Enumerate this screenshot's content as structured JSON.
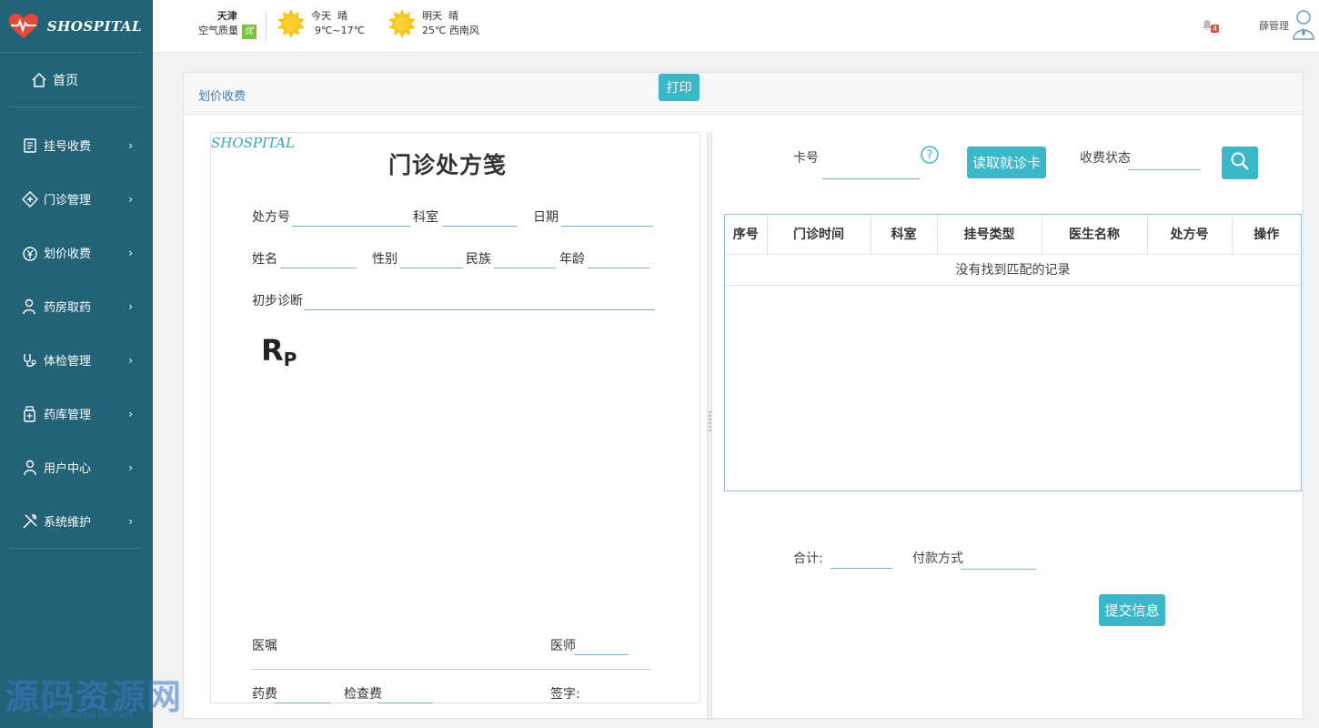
{
  "brand": {
    "name": "SHOSPITAL"
  },
  "sidebar": {
    "home": "首页",
    "items": [
      {
        "label": "挂号收费",
        "icon": "receipt-icon"
      },
      {
        "label": "门诊管理",
        "icon": "clinic-icon"
      },
      {
        "label": "划价收费",
        "icon": "yuan-icon"
      },
      {
        "label": "药房取药",
        "icon": "pharmacy-icon"
      },
      {
        "label": "体检管理",
        "icon": "stethoscope-icon"
      },
      {
        "label": "药库管理",
        "icon": "medicine-bottle-icon"
      },
      {
        "label": "用户中心",
        "icon": "user-icon"
      },
      {
        "label": "系统维护",
        "icon": "tools-icon"
      }
    ]
  },
  "topbar": {
    "city": "天津",
    "air_quality_label": "空气质量",
    "air_quality_value": "优",
    "today": {
      "day": "今天",
      "condition": "晴",
      "temp": "9℃~17℃"
    },
    "tomorrow": {
      "day": "明天",
      "condition": "晴",
      "detail": "25℃ 西南风"
    },
    "notifications": "4",
    "user": "薛管理"
  },
  "panel": {
    "title": "划价收费",
    "print_label": "打印"
  },
  "prescription": {
    "logo": "SHOSPITAL",
    "title": "门诊处方笺",
    "rx_no_label": "处方号",
    "dept_label": "科室",
    "date_label": "日期",
    "name_label": "姓名",
    "gender_label": "性别",
    "ethnicity_label": "民族",
    "age_label": "年龄",
    "diagnosis_label": "初步诊断",
    "rp": "R",
    "rp_sub": "P",
    "advice_label": "医嘱",
    "doctor_label": "医师",
    "drug_fee_label": "药费",
    "exam_fee_label": "检查费",
    "sign_label": "签字:"
  },
  "charge": {
    "card_label": "卡号",
    "read_card_label": "读取就诊卡",
    "status_label": "收费状态",
    "table": {
      "columns": [
        "序号",
        "门诊时间",
        "科室",
        "挂号类型",
        "医生名称",
        "处方号",
        "操作"
      ],
      "empty_text": "没有找到匹配的记录"
    },
    "total_label": "合计:",
    "payment_label": "付款方式",
    "submit_label": "提交信息"
  },
  "watermark": {
    "main": "源码资源网",
    "sub": "http://www.net188.com"
  }
}
